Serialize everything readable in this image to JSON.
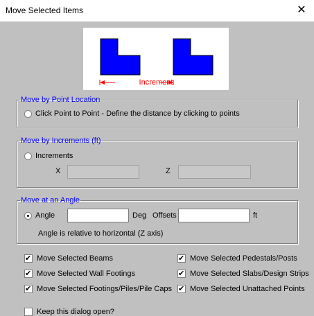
{
  "window": {
    "title": "Move Selected Items",
    "close_glyph": "✕"
  },
  "illustration": {
    "increment_label": "Increment",
    "shape_color": "#0000ff",
    "label_color": "#ff0000"
  },
  "point_group": {
    "legend": "Move by Point Location",
    "option_label": "Click Point to Point - Define the distance by clicking to points",
    "selected": false
  },
  "increments_group": {
    "legend": "Move by Increments (ft)",
    "option_label": "Increments",
    "selected": false,
    "x_label": "X",
    "z_label": "Z",
    "x_value": "",
    "z_value": ""
  },
  "angle_group": {
    "legend": "Move at an Angle",
    "option_label": "Angle",
    "selected": true,
    "angle_value": "",
    "deg_label": "Deg",
    "offsets_label": "Offsets",
    "offsets_value": "",
    "ft_label": "ft",
    "note": "Angle is relative to horizontal (Z axis)"
  },
  "checkboxes": {
    "beams": {
      "label": "Move Selected Beams",
      "checked": true
    },
    "wall_footings": {
      "label": "Move Selected Wall Footings",
      "checked": true
    },
    "footings": {
      "label": "Move Selected Footings/Piles/Pile Caps",
      "checked": true
    },
    "pedestals": {
      "label": "Move Selected Pedestals/Posts",
      "checked": true
    },
    "slabs": {
      "label": "Move Selected Slabs/Design Strips",
      "checked": true
    },
    "unattached": {
      "label": "Move Selected Unattached Points",
      "checked": true
    },
    "keep_open": {
      "label": "Keep this dialog open?",
      "checked": false
    }
  }
}
